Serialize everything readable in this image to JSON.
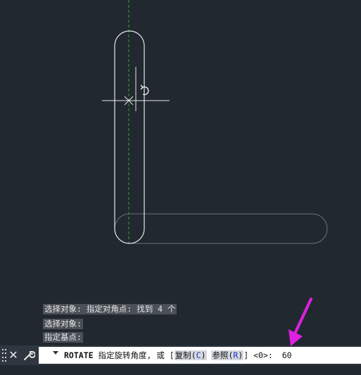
{
  "colors": {
    "background": "#212830",
    "centerline": "#2ea82e",
    "slot": "#e6e6e6",
    "ghost": "#6e7378",
    "history_bg": "#4b5058",
    "option_bg": "#d4d9df",
    "option_key": "#1b33c8",
    "annotation_arrow": "#e020e0"
  },
  "drawing": {
    "cursor_icon": "rotate-cursor-icon"
  },
  "history": [
    "选择对象: 指定对角点: 找到 4 个",
    "选择对象:",
    "指定基点:"
  ],
  "command_line": {
    "close_icon": "close-icon",
    "settings_icon": "wrench-icon",
    "dropdown_icon": "chevron-down-icon",
    "command_name": "ROTATE",
    "prompt": "指定旋转角度, 或 [",
    "option_copy_label": "复制",
    "option_copy_key": "C",
    "option_reference_label": "参照",
    "option_reference_key": "R",
    "prompt_tail": "] <0>:",
    "value": "60"
  }
}
